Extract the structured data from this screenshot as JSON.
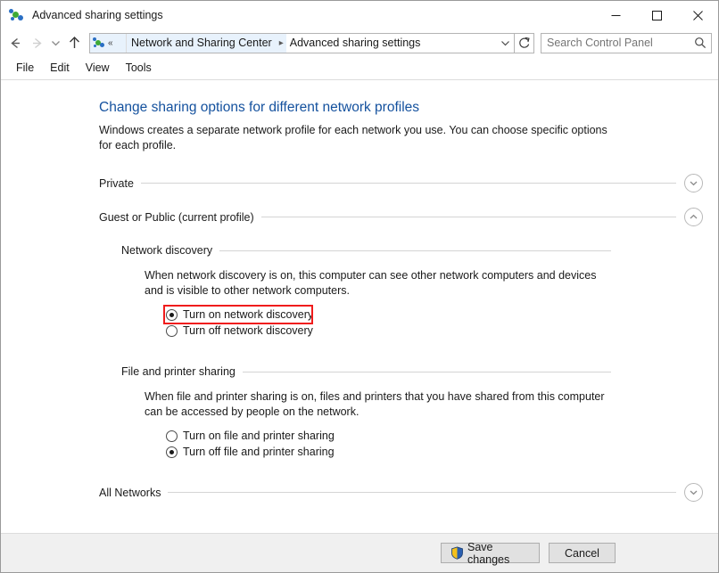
{
  "window": {
    "title": "Advanced sharing settings",
    "icon": "network-sharing-icon",
    "controls": {
      "minimize": "minimize-icon",
      "maximize": "maximize-icon",
      "close": "close-icon"
    }
  },
  "toolbar": {
    "back": "back-arrow-icon",
    "forward": "forward-arrow-icon",
    "recent": "recent-locations-chevron-icon",
    "up": "up-arrow-icon",
    "refresh": "refresh-icon",
    "breadcrumb_dropdown": "chevron-down-icon",
    "breadcrumb": [
      "Network and Sharing Center",
      "Advanced sharing settings"
    ],
    "breadcrumb_overflow": "«"
  },
  "search": {
    "placeholder": "Search Control Panel",
    "value": "",
    "icon": "search-icon"
  },
  "menubar": {
    "items": [
      "File",
      "Edit",
      "View",
      "Tools"
    ]
  },
  "page": {
    "heading": "Change sharing options for different network profiles",
    "description": "Windows creates a separate network profile for each network you use. You can choose specific options for each profile."
  },
  "profiles": [
    {
      "name": "Private",
      "expanded": false,
      "chevron": "chevron-down-icon"
    },
    {
      "name": "Guest or Public (current profile)",
      "expanded": true,
      "chevron": "chevron-up-icon"
    },
    {
      "name": "All Networks",
      "expanded": false,
      "chevron": "chevron-down-icon"
    }
  ],
  "sections": [
    {
      "title": "Network discovery",
      "description": "When network discovery is on, this computer can see other network computers and devices and is visible to other network computers.",
      "options": [
        {
          "label": "Turn on network discovery",
          "checked": true,
          "highlighted": true
        },
        {
          "label": "Turn off network discovery",
          "checked": false,
          "highlighted": false
        }
      ]
    },
    {
      "title": "File and printer sharing",
      "description": "When file and printer sharing is on, files and printers that you have shared from this computer can be accessed by people on the network.",
      "options": [
        {
          "label": "Turn on file and printer sharing",
          "checked": false,
          "highlighted": false
        },
        {
          "label": "Turn off file and printer sharing",
          "checked": true,
          "highlighted": false
        }
      ]
    }
  ],
  "footer": {
    "save_label": "Save changes",
    "save_icon": "uac-shield-icon",
    "cancel_label": "Cancel"
  },
  "colors": {
    "heading_blue": "#14519e",
    "highlight_red": "#f01c1c",
    "breadcrumb_highlight": "#e8f2fc",
    "footer_bg": "#f0f0f0",
    "shield_yellow": "#f3c01c",
    "shield_blue": "#2a5fb0",
    "icon_green": "#3faa35",
    "icon_blue": "#2a6fc4"
  }
}
